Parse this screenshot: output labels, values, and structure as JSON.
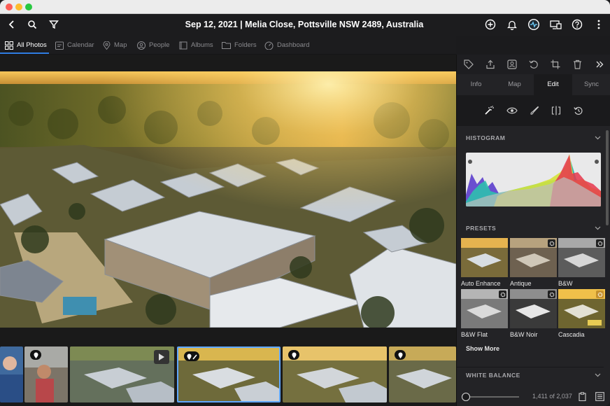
{
  "window": {
    "title": "Sep 12, 2021 | Melia Close, Pottsville NSW 2489, Australia"
  },
  "tabs": [
    {
      "label": "All Photos",
      "icon": "grid-icon"
    },
    {
      "label": "Calendar",
      "icon": "calendar-icon"
    },
    {
      "label": "Map",
      "icon": "map-pin-icon"
    },
    {
      "label": "People",
      "icon": "person-icon"
    },
    {
      "label": "Albums",
      "icon": "album-icon"
    },
    {
      "label": "Folders",
      "icon": "folder-icon"
    },
    {
      "label": "Dashboard",
      "icon": "dashboard-icon"
    }
  ],
  "right_panel": {
    "tabs": [
      "Info",
      "Map",
      "Edit",
      "Sync"
    ],
    "active_tab": "Edit",
    "histogram_title": "HISTOGRAM",
    "presets_title": "PRESETS",
    "presets": [
      "Auto Enhance",
      "Antique",
      "B&W",
      "B&W Flat",
      "B&W Noir",
      "Cascadia"
    ],
    "show_more": "Show More",
    "white_balance_title": "WHITE BALANCE",
    "counter": "1,411 of 2,037"
  },
  "colors": {
    "accent": "#2f7de1",
    "selected_thumb": "#5fa8ff",
    "active_tab_text": "#ffffff"
  }
}
